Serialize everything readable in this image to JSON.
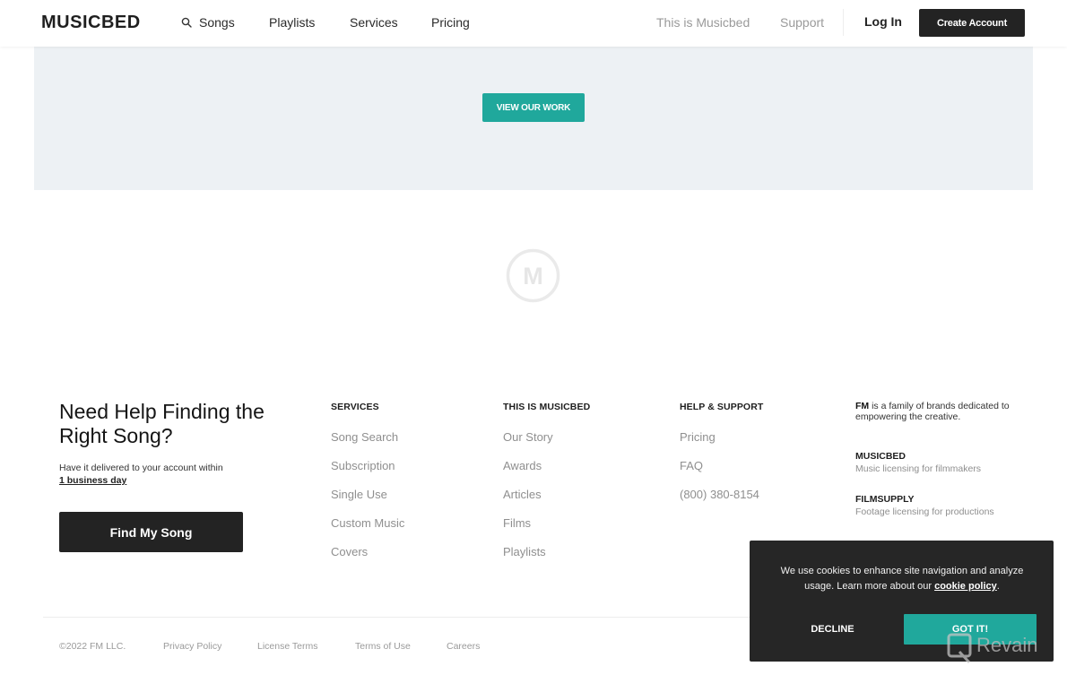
{
  "header": {
    "logo": "MUSICBED",
    "nav": [
      {
        "label": "Songs",
        "icon": "search-icon"
      },
      {
        "label": "Playlists"
      },
      {
        "label": "Services"
      },
      {
        "label": "Pricing"
      }
    ],
    "secondary_nav": [
      {
        "label": "This is Musicbed"
      },
      {
        "label": "Support"
      }
    ],
    "login_label": "Log In",
    "create_account_label": "Create Account"
  },
  "hero": {
    "button_label": "VIEW OUR WORK",
    "accent_color": "#20a89c"
  },
  "center_logo": {
    "icon": "musicbed-m-logo-icon",
    "letter": "M"
  },
  "help": {
    "title": "Need Help Finding the Right Song?",
    "subtitle": "Have it delivered to your account within",
    "subtitle_link": "1 business day",
    "button_label": "Find My Song"
  },
  "footer_columns": [
    {
      "heading": "SERVICES",
      "links": [
        "Song Search",
        "Subscription",
        "Single Use",
        "Custom Music",
        "Covers"
      ]
    },
    {
      "heading": "THIS IS MUSICBED",
      "links": [
        "Our Story",
        "Awards",
        "Articles",
        "Films",
        "Playlists"
      ]
    },
    {
      "heading": "HELP & SUPPORT",
      "links": [
        "Pricing",
        "FAQ",
        "(800) 380-8154"
      ]
    }
  ],
  "fm": {
    "intro_bold": "FM",
    "intro_rest": " is a family of brands dedicated to empowering the creative.",
    "brands": [
      {
        "name": "MUSICBED",
        "description": "Music licensing for filmmakers"
      },
      {
        "name": "FILMSUPPLY",
        "description": "Footage licensing for productions"
      }
    ]
  },
  "bottom_bar": {
    "copyright": "©2022 FM LLC.",
    "links": [
      "Privacy Policy",
      "License Terms",
      "Terms of Use",
      "Careers"
    ]
  },
  "cookie_banner": {
    "text": "We use cookies to enhance site navigation and analyze usage. Learn more about our ",
    "link": "cookie policy",
    "text_end": ".",
    "decline_label": "DECLINE",
    "accept_label": "GOT IT!"
  },
  "watermark": {
    "text": "Revain"
  }
}
